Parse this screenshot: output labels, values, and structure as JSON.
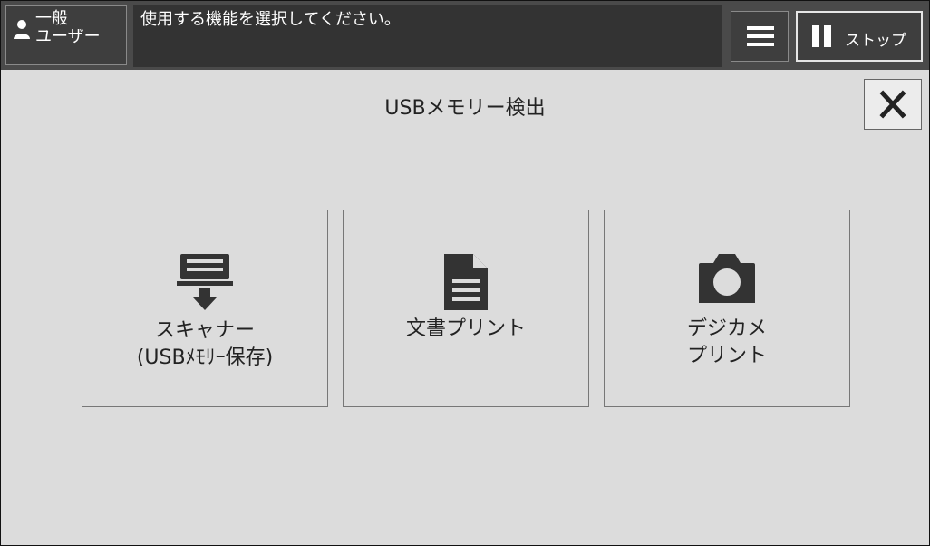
{
  "header": {
    "user": {
      "line1": "一般",
      "line2": "ユーザー",
      "icon": "person-icon"
    },
    "message": "使用する機能を選択してください。",
    "menu_icon": "hamburger-menu-icon",
    "stop": {
      "label": "ストップ",
      "icon": "pause-icon"
    }
  },
  "main": {
    "title": "USBメモリー検出",
    "close_icon": "close-icon",
    "tiles": [
      {
        "line1": "スキャナー",
        "line2": "(USBﾒﾓﾘｰ保存)",
        "icon": "scan-to-usb-icon"
      },
      {
        "line1": "文書プリント",
        "line2": "",
        "icon": "document-icon"
      },
      {
        "line1": "デジカメ",
        "line2": "プリント",
        "icon": "camera-icon"
      }
    ]
  },
  "colors": {
    "topbar": "#4a4a4a",
    "message_area": "#333333",
    "background": "#dcdcdc",
    "icon": "#333333"
  }
}
